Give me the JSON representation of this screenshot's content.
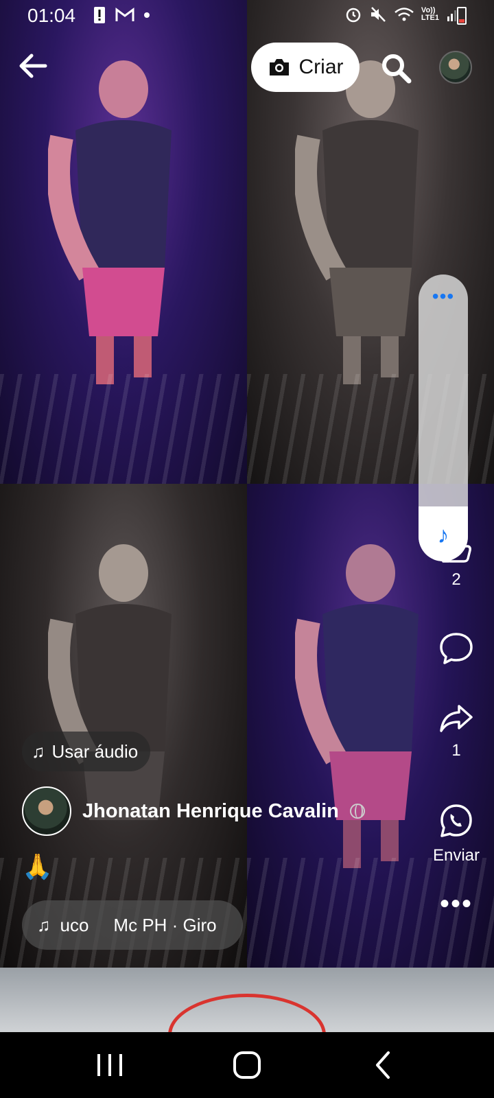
{
  "status_bar": {
    "time": "01:04",
    "volte_label": "Vo))",
    "network_label": "LTE1"
  },
  "top_bar": {
    "create_label": "Criar"
  },
  "actions": {
    "like_count": "2",
    "share_count": "1",
    "send_label": "Enviar"
  },
  "post": {
    "use_audio_label": "Usar áudio",
    "author_name": "Jhonatan Henrique Cavalin",
    "caption": "🙏",
    "music_text_fragment": "uco",
    "music_text": "Mc PH · Giro"
  },
  "icons": {
    "back": "arrow-left",
    "camera": "camera",
    "search": "magnifier",
    "more": "ellipsis",
    "music": "music-note",
    "like": "thumbs-up",
    "comment": "speech-bubble",
    "share": "forward-arrow",
    "send": "whatsapp",
    "globe": "globe"
  },
  "colors": {
    "accent": "#1877f2",
    "create_button_bg": "#ffffff",
    "pill_bg": "rgba(40,40,40,0.72)"
  }
}
